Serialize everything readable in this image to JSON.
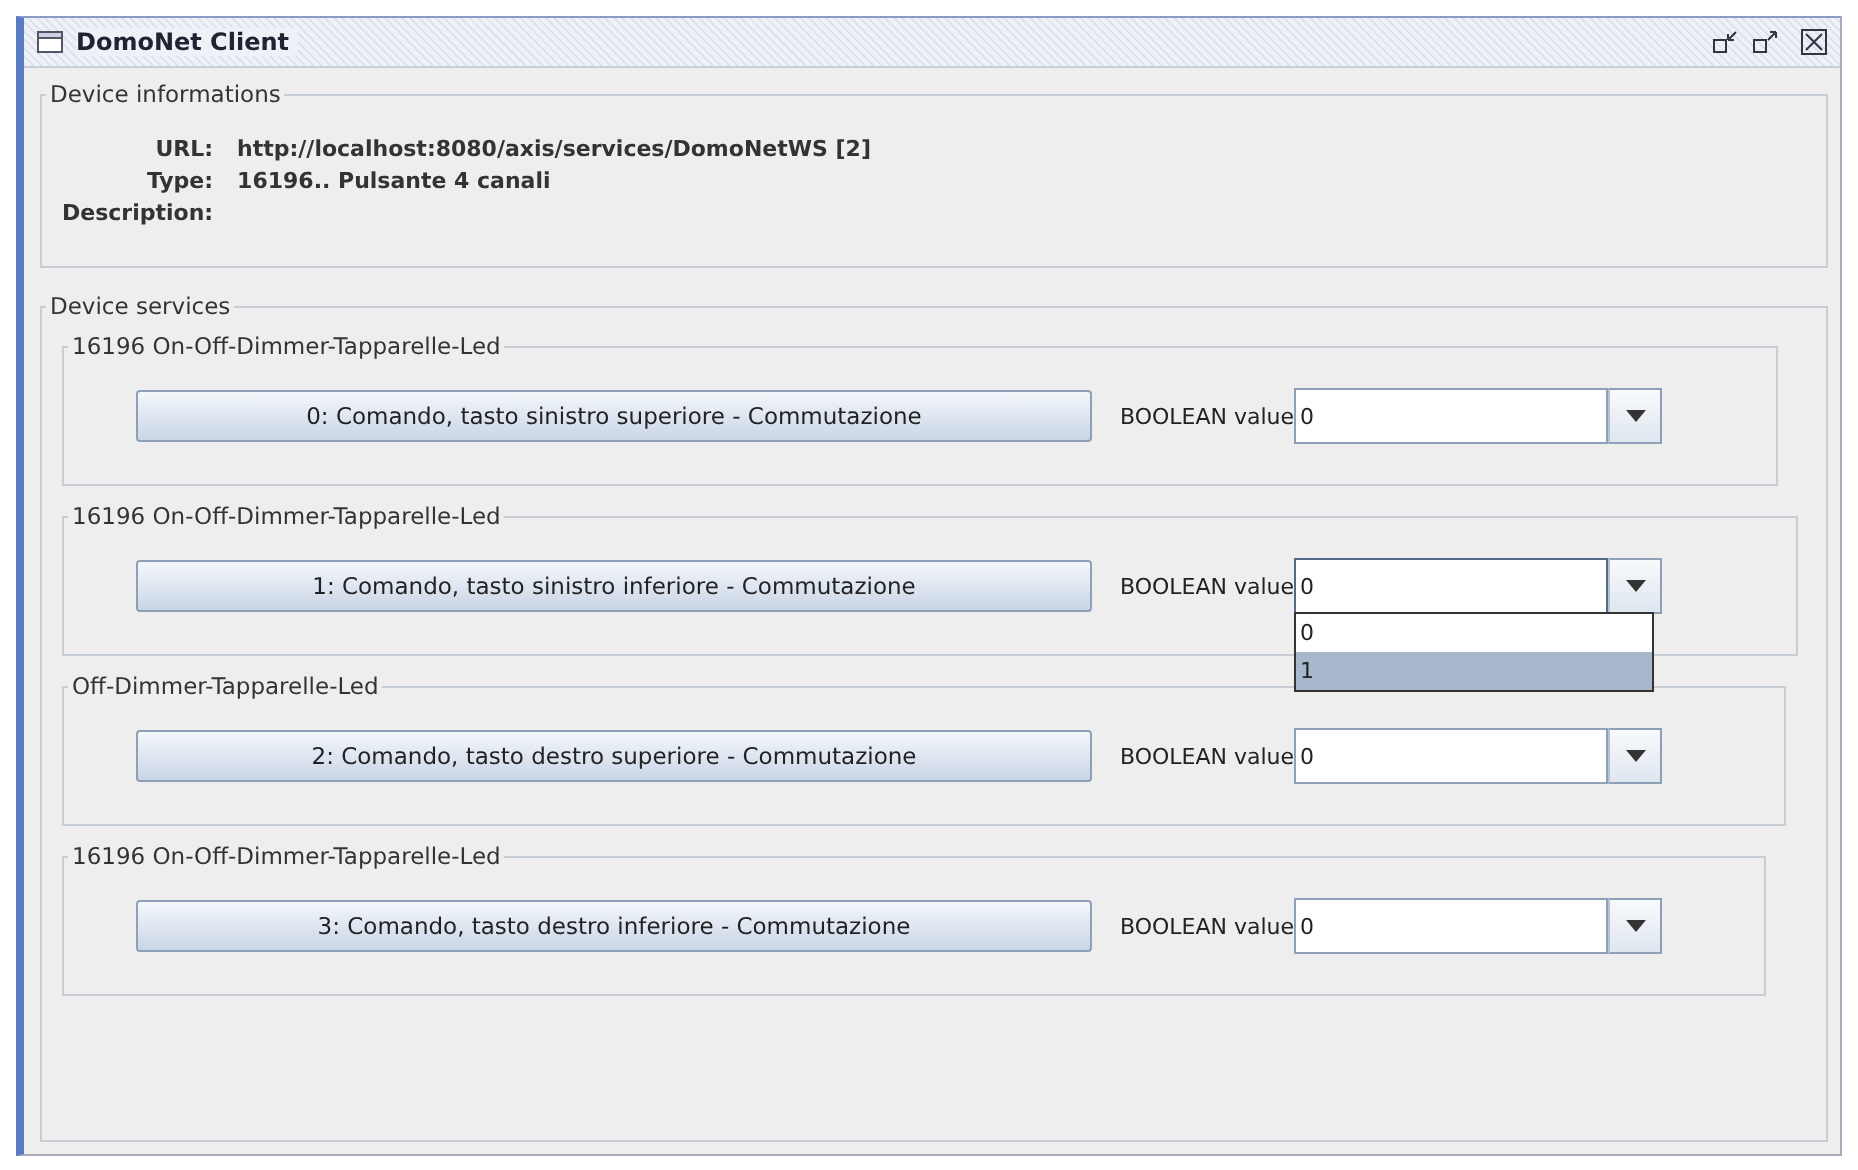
{
  "window": {
    "title": "DomoNet Client"
  },
  "device_info": {
    "title": "Device informations",
    "fields": [
      {
        "label": "URL:",
        "value": "http://localhost:8080/axis/services/DomoNetWS [2]"
      },
      {
        "label": "Type:",
        "value": "16196.. Pulsante 4 canali"
      },
      {
        "label": "Description:"
      }
    ]
  },
  "device_services": {
    "title": "Device services",
    "groups": [
      {
        "title": "16196 On-Off-Dimmer-Tapparelle-Led",
        "button": "0: Comando, tasto sinistro superiore - Commutazione",
        "value_label": "BOOLEAN value",
        "value": "0",
        "expanded": false
      },
      {
        "title": "16196 On-Off-Dimmer-Tapparelle-Led",
        "button": "1: Comando, tasto sinistro inferiore - Commutazione",
        "value_label": "BOOLEAN value",
        "value": "0",
        "expanded": true,
        "options": [
          {
            "label": "0",
            "highlighted": false
          },
          {
            "label": "1",
            "highlighted": true
          }
        ]
      },
      {
        "title": "Off-Dimmer-Tapparelle-Led",
        "button": "2: Comando, tasto destro superiore - Commutazione",
        "value_label": "BOOLEAN value",
        "value": "0",
        "expanded": false
      },
      {
        "title": "16196 On-Off-Dimmer-Tapparelle-Led",
        "button": "3: Comando, tasto destro inferiore - Commutazione",
        "value_label": "BOOLEAN value",
        "value": "0",
        "expanded": false
      }
    ]
  }
}
